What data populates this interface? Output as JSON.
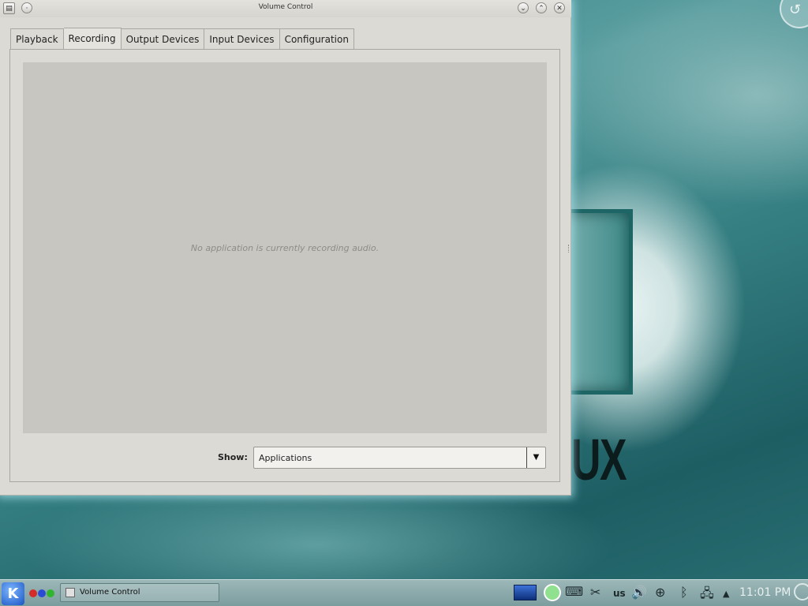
{
  "window": {
    "title": "Volume Control"
  },
  "tabs": [
    {
      "label": "Playback"
    },
    {
      "label": "Recording"
    },
    {
      "label": "Output Devices"
    },
    {
      "label": "Input Devices"
    },
    {
      "label": "Configuration"
    }
  ],
  "active_tab": "Recording",
  "content": {
    "empty_message": "No application is currently recording audio."
  },
  "show": {
    "label": "Show:",
    "value": "Applications"
  },
  "desktop": {
    "wallpaper_text": "UX"
  },
  "taskbar": {
    "task_label": "Volume Control",
    "keyboard_layout": "us",
    "clock": "11:01 PM"
  },
  "colors": {
    "window_bg": "#dcdad5",
    "content_bg": "#c8c6c0",
    "wallpaper_teal": "#2f7c7e"
  }
}
